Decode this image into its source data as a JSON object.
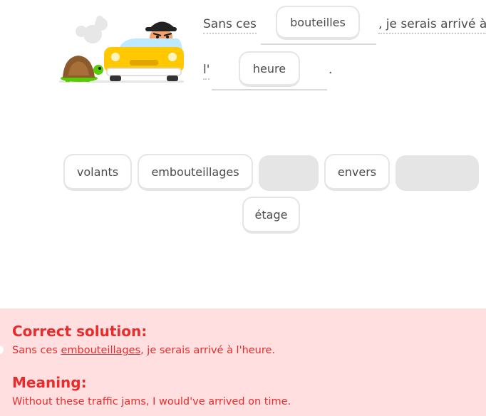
{
  "sentence": {
    "line1_start": "Sans ces",
    "line1_end": ", je serais arrivé à",
    "line2_start": "l'",
    "line2_end": "."
  },
  "placed_tiles": [
    "bouteilles",
    "heure"
  ],
  "word_bank": {
    "tile_1": "volants",
    "tile_2": "embouteillages",
    "tile_3": "envers",
    "tile_4": "étage"
  },
  "feedback": {
    "solution_title": "Correct solution:",
    "solution_pre": "Sans ces ",
    "solution_highlight": "embouteillages",
    "solution_post": ", je serais arrivé à l'heure.",
    "meaning_title": "Meaning:",
    "meaning_text": "Without these traffic jams, I would've arrived on time."
  },
  "colors": {
    "error_red": "#ea2b2b",
    "error_bg": "#ffdfe0",
    "tile_border": "#e5e5e5",
    "car_yellow": "#ffc800",
    "turtle_green": "#58cc02"
  },
  "icons": {
    "illustration": "turtle-and-angry-driver-car"
  }
}
